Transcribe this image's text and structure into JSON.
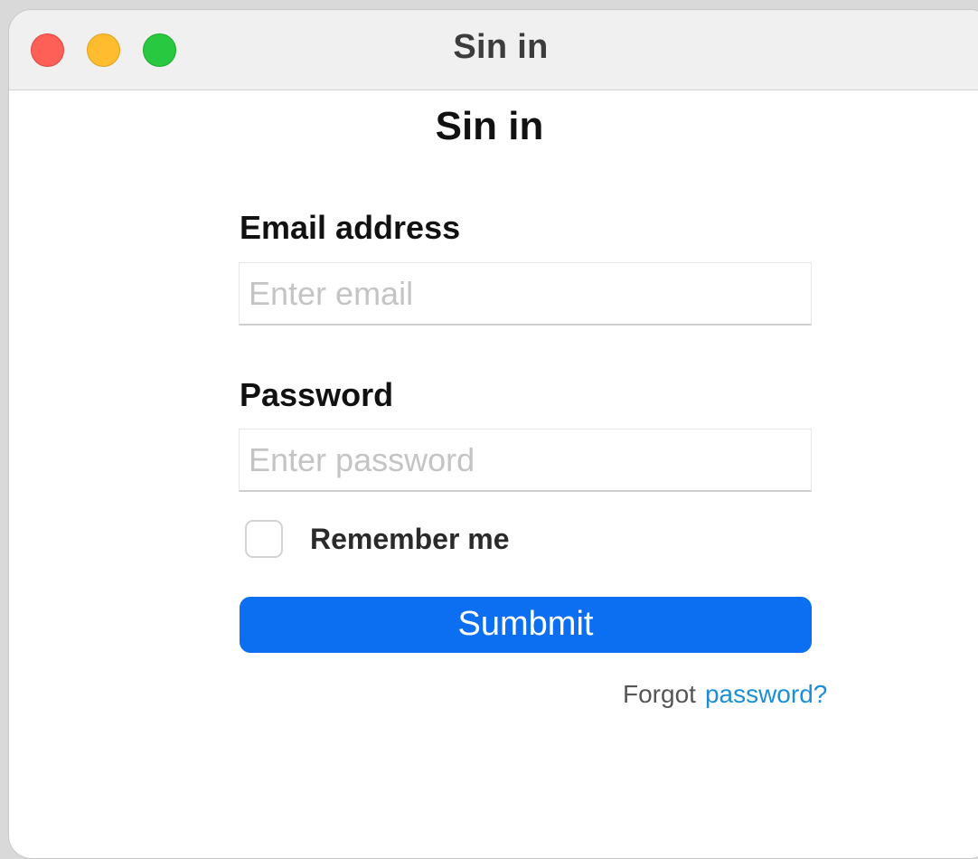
{
  "window": {
    "title": "Sin in"
  },
  "page": {
    "heading": "Sin in"
  },
  "email": {
    "label": "Email address",
    "placeholder": "Enter email",
    "value": ""
  },
  "password": {
    "label": "Password",
    "placeholder": "Enter password",
    "value": ""
  },
  "remember": {
    "label": "Remember me",
    "checked": false
  },
  "submit": {
    "label": "Sumbmit",
    "color": "#0c6ff2"
  },
  "forgot": {
    "prefix": "Forgot",
    "link_text": "password?",
    "link_color": "#1a8fd8"
  },
  "traffic_lights": {
    "close_color": "#fe5f57",
    "minimize_color": "#febc2e",
    "zoom_color": "#28c840"
  }
}
